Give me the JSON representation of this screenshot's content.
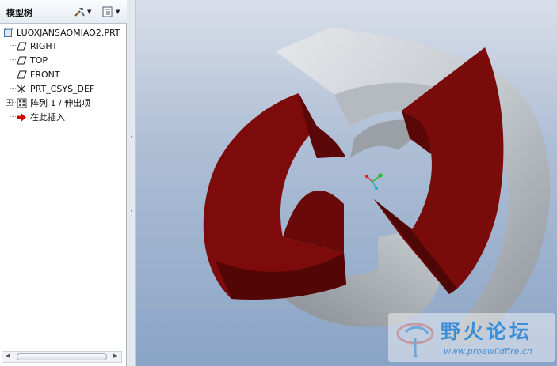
{
  "panel": {
    "title": "模型树",
    "tools_icon": "tools-icon",
    "settings_icon": "tree-settings-icon"
  },
  "tree": {
    "items": [
      {
        "label": "LUOXJANSAOMIAO2.PRT",
        "icon": "part-icon"
      },
      {
        "label": "RIGHT",
        "icon": "datum-plane-icon"
      },
      {
        "label": "TOP",
        "icon": "datum-plane-icon"
      },
      {
        "label": "FRONT",
        "icon": "datum-plane-icon"
      },
      {
        "label": "PRT_CSYS_DEF",
        "icon": "coordinate-system-icon"
      },
      {
        "label": "阵列 1 / 伸出项",
        "icon": "pattern-icon"
      },
      {
        "label": "在此插入",
        "icon": "insert-here-arrow-icon"
      }
    ]
  },
  "watermark": {
    "text": "野火论坛",
    "url": "www.proewildfire.cn"
  },
  "colors": {
    "model_gray": "#c6cbd0",
    "model_red": "#7d0b0b",
    "viewport_top": "#d8dee9",
    "viewport_bottom": "#8aa4c6"
  }
}
